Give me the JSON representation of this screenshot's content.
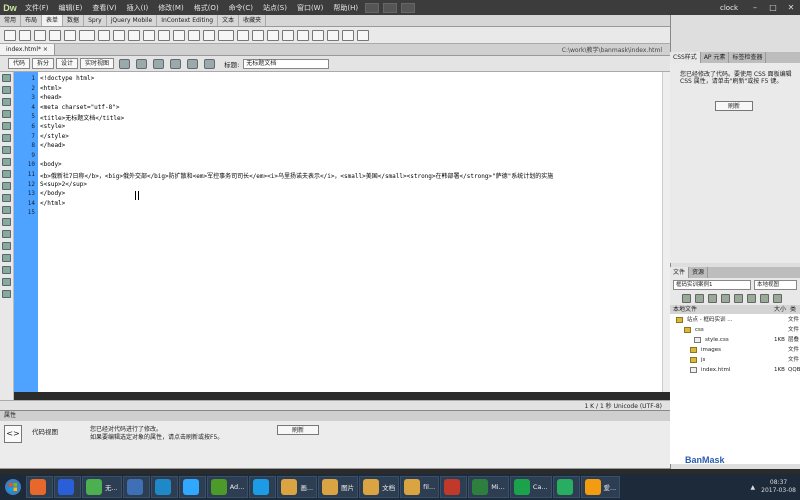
{
  "app": {
    "logo": "Dw",
    "user": "clock",
    "win_min": "–",
    "win_max": "□",
    "win_close": "✕"
  },
  "menu": [
    "文件(F)",
    "编辑(E)",
    "查看(V)",
    "插入(I)",
    "修改(M)",
    "格式(O)",
    "命令(C)",
    "站点(S)",
    "窗口(W)",
    "帮助(H)"
  ],
  "insert_tabs": [
    "常用",
    "布局",
    "表单",
    "数据",
    "Spry",
    "jQuery Mobile",
    "InContext Editing",
    "文本",
    "收藏夹"
  ],
  "insert_active": 2,
  "doc": {
    "tab": "index.html*",
    "close": "×",
    "path": "C:\\work\\教学\\banmask\\index.html"
  },
  "viewbar": {
    "code": "代码",
    "split": "拆分",
    "design": "设计",
    "live": "实时视图",
    "title_label": "标题:",
    "title_value": "无标题文档"
  },
  "code_lines": [
    "<!doctype html>",
    "<html>",
    "<head>",
    "<meta charset=\"utf-8\">",
    "<title>无标题文档</title>",
    "<style>",
    "</style>",
    "</head>",
    "",
    "<body>",
    "<b>俄新社7日称</b>，<big>俄外交部</big>防扩散和<em>军控事务司司长</em><i>乌里扬诺夫表示</i>，<small>美国</small><strong>在韩部署</strong>\"萨德\"系统计划的实施",
    "S<sup>2</sup>",
    "</body>",
    "</html>",
    ""
  ],
  "status": {
    "text": "1 K / 1 秒  Unicode (UTF-8)"
  },
  "properties": {
    "header": "属性",
    "view": "代码视图",
    "msg1": "您已经对代码进行了修改。",
    "msg2": "如果要编辑选定对象的属性，请点击刷新或按F5。",
    "refresh": "刷新"
  },
  "right": {
    "tabs": [
      "CSS样式",
      "AP 元素",
      "标签检查器"
    ],
    "css_msg": "您已经修改了代码。要使用 CSS 面板编辑 CSS 属性，请单击\"刷新\"或按 F5 键。",
    "css_refresh": "刷新",
    "file_tabs": [
      "文件",
      "资源"
    ],
    "site_select": "框码实训案例1",
    "view_select": "本地视图",
    "col_name": "本地文件",
    "col_size": "大小",
    "col_type": "类",
    "files": [
      {
        "name": "站点 - 框码实训 ...",
        "size": "",
        "type": "文件"
      },
      {
        "name": "css",
        "size": "",
        "type": "文件"
      },
      {
        "name": "style.css",
        "size": "1KB",
        "type": "层叠"
      },
      {
        "name": "images",
        "size": "",
        "type": "文件"
      },
      {
        "name": "js",
        "size": "",
        "type": "文件"
      },
      {
        "name": "index.html",
        "size": "1KB",
        "type": "QQB"
      }
    ],
    "watermark": "BanMask",
    "login": "登"
  },
  "taskbar": {
    "items": [
      {
        "label": "",
        "color": "#e8672b"
      },
      {
        "label": "",
        "color": "#2a5fd8"
      },
      {
        "label": "无...",
        "color": "#4caf50"
      },
      {
        "label": "",
        "color": "#3f6fb5"
      },
      {
        "label": "",
        "color": "#1e88c8"
      },
      {
        "label": "",
        "color": "#31a8ff"
      },
      {
        "label": "Ad...",
        "color": "#4c9a2a"
      },
      {
        "label": "",
        "color": "#1c9be6"
      },
      {
        "label": "画...",
        "color": "#d9a441"
      },
      {
        "label": "图片",
        "color": "#d9a441"
      },
      {
        "label": "文档",
        "color": "#d9a441"
      },
      {
        "label": "fil...",
        "color": "#d9a441"
      },
      {
        "label": "",
        "color": "#c0392b"
      },
      {
        "label": "Mi...",
        "color": "#2d7f3e"
      },
      {
        "label": "Ca...",
        "color": "#1aa34a"
      },
      {
        "label": "",
        "color": "#27ae60"
      },
      {
        "label": "爱...",
        "color": "#f39c12"
      }
    ],
    "time": "08:37",
    "date": "2017-03-08"
  },
  "colors": {
    "gutter": "#4da3ff",
    "menubar": "#3c3c3c",
    "taskbar": "#1d2a3a",
    "accent": "#c9e7a3"
  }
}
